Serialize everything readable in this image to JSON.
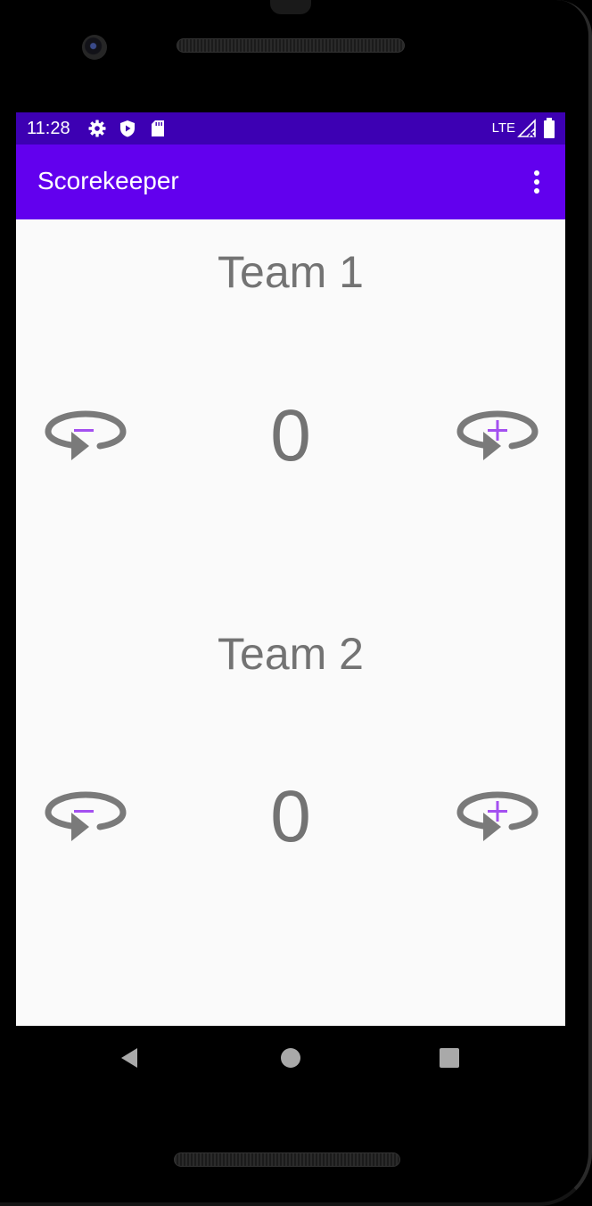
{
  "status_bar": {
    "time": "11:28",
    "network": "LTE",
    "icons": [
      "gear-icon",
      "shield-icon",
      "sd-card-icon",
      "signal-icon",
      "battery-icon"
    ],
    "background": "#3d00b3"
  },
  "app_bar": {
    "title": "Scorekeeper",
    "background": "#6200ee",
    "menu_icon": "overflow-menu-icon"
  },
  "teams": [
    {
      "label": "Team 1",
      "score": "0",
      "decrease_icon": "minus-rotate-icon",
      "increase_icon": "plus-rotate-icon"
    },
    {
      "label": "Team 2",
      "score": "0",
      "decrease_icon": "minus-rotate-icon",
      "increase_icon": "plus-rotate-icon"
    }
  ],
  "colors": {
    "text_gray": "#737373",
    "icon_accent": "#a450f0",
    "screen_bg": "#fafafa"
  },
  "nav_bar": {
    "icons": [
      "back-icon",
      "home-icon",
      "recents-icon"
    ]
  }
}
